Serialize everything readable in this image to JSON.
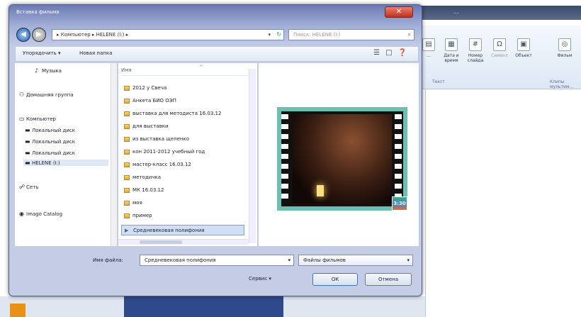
{
  "background_app": {
    "title": "...",
    "ribbon": {
      "buttons": [
        {
          "label": "...",
          "icon": "insert-icon"
        },
        {
          "label": "Дата и время",
          "icon": "calendar-icon"
        },
        {
          "label": "Номер слайда",
          "icon": "slide-number-icon"
        },
        {
          "label": "Символ",
          "icon": "omega-icon"
        },
        {
          "label": "Объект",
          "icon": "object-icon"
        },
        {
          "label": "Фильм",
          "icon": "film-icon"
        }
      ],
      "groups": [
        "Текст",
        "Клипы мультим..."
      ]
    }
  },
  "dialog": {
    "title": "Вставка фильма",
    "close_label": "✕",
    "address": {
      "path": "▸ Компьютер ▸ HELENE (I:) ▸",
      "search_placeholder": "Поиск: HELENE (I:)"
    },
    "toolbar": {
      "organize_label": "Упорядочить ▾",
      "new_folder_label": "Новая папка"
    },
    "nav_items": [
      {
        "label": "Музыка",
        "icon": "music-icon"
      },
      {
        "label": "Домашняя группа",
        "icon": "homegroup-icon"
      },
      {
        "label": "Компьютер",
        "icon": "computer-icon"
      },
      {
        "label": "Локальный диск",
        "icon": "drive-icon"
      },
      {
        "label": "Локальный диск",
        "icon": "drive-icon"
      },
      {
        "label": "Локальный диск",
        "icon": "drive-icon"
      },
      {
        "label": "HELENE (I:)",
        "icon": "usb-drive-icon"
      },
      {
        "label": "Сеть",
        "icon": "network-icon"
      },
      {
        "label": "Imago Catalog",
        "icon": "catalog-icon"
      }
    ],
    "file_list": {
      "column_header": "Имя",
      "items": [
        {
          "name": "2012 у Свеча",
          "type": "folder"
        },
        {
          "name": "Анкета БИО ОЭП",
          "type": "folder"
        },
        {
          "name": "выставка для методиста 16.03.12",
          "type": "folder"
        },
        {
          "name": "для выставки",
          "type": "folder"
        },
        {
          "name": "из выставка щеленко",
          "type": "folder"
        },
        {
          "name": "кон 2011-2012 учебный год",
          "type": "folder"
        },
        {
          "name": "мастер-класс 16.03.12",
          "type": "folder"
        },
        {
          "name": "методичка",
          "type": "folder"
        },
        {
          "name": "МК 16.03.12",
          "type": "folder"
        },
        {
          "name": "моя",
          "type": "folder"
        },
        {
          "name": "пример",
          "type": "folder"
        },
        {
          "name": "Средневековая полифония",
          "type": "video",
          "selected": true
        }
      ]
    },
    "preview": {
      "badge": "3:30"
    },
    "bottom": {
      "filename_label": "Имя файла:",
      "filename_value": "Средневековая полифония",
      "filetype_value": "Файлы фильмов",
      "service_label": "Сервис ▾",
      "ok_label": "ОК",
      "cancel_label": "Отмена"
    }
  }
}
